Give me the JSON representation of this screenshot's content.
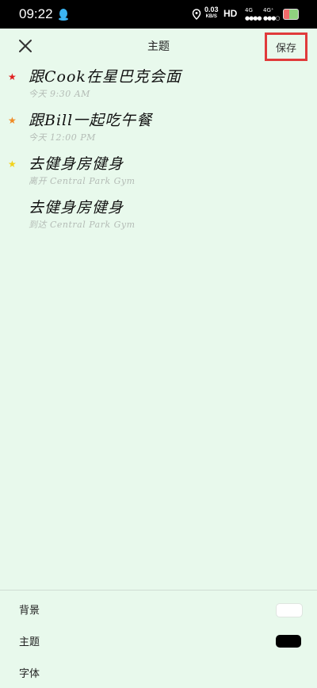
{
  "status_bar": {
    "time": "09:22",
    "net_speed_value": "0.03",
    "net_speed_unit": "KB/S",
    "hd_label": "HD",
    "signal_1_label": "4G",
    "signal_2_label": "4G⁺",
    "icons": [
      "qq-icon",
      "location-icon",
      "signal-icon",
      "battery-icon"
    ]
  },
  "header": {
    "title": "主题",
    "save_label": "保存",
    "close_icon": "close-icon"
  },
  "items": [
    {
      "title": "跟Cook在星巴克会面",
      "subtitle": "今天 9:30 AM",
      "star_color": "#e02020"
    },
    {
      "title": "跟Bill一起吃午餐",
      "subtitle": "今天 12:00 PM",
      "star_color": "#f08a24"
    },
    {
      "title": "去健身房健身",
      "subtitle": "离开 Central Park Gym",
      "star_color": "#f2d21a"
    },
    {
      "title": "去健身房健身",
      "subtitle": "到达 Central Park Gym",
      "star_color": ""
    }
  ],
  "settings": {
    "background_label": "背景",
    "background_color": "#ffffff",
    "theme_label": "主题",
    "theme_color": "#000000",
    "font_label": "字体"
  }
}
